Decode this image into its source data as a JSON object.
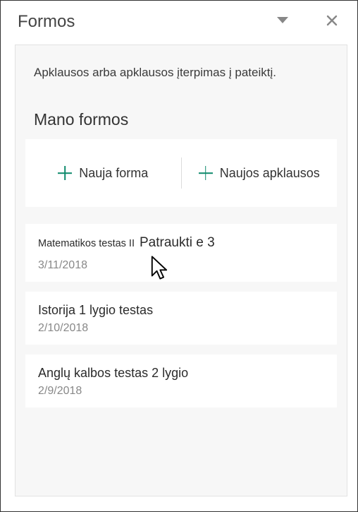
{
  "header": {
    "title": "Formos"
  },
  "intro": "Apklausos arba apklausos įterpimas į pateiktį.",
  "section_title": "Mano formos",
  "new_buttons": {
    "form": "Nauja forma",
    "survey": "Naujos apklausos"
  },
  "forms": [
    {
      "title_a": "Matematikos testas II",
      "title_b": "Patraukti e 3",
      "date": "3/11/2018"
    },
    {
      "title": "Istorija 1 lygio testas",
      "date": "2/10/2018"
    },
    {
      "title": "Anglų kalbos testas 2 lygio",
      "date": "2/9/2018"
    }
  ]
}
